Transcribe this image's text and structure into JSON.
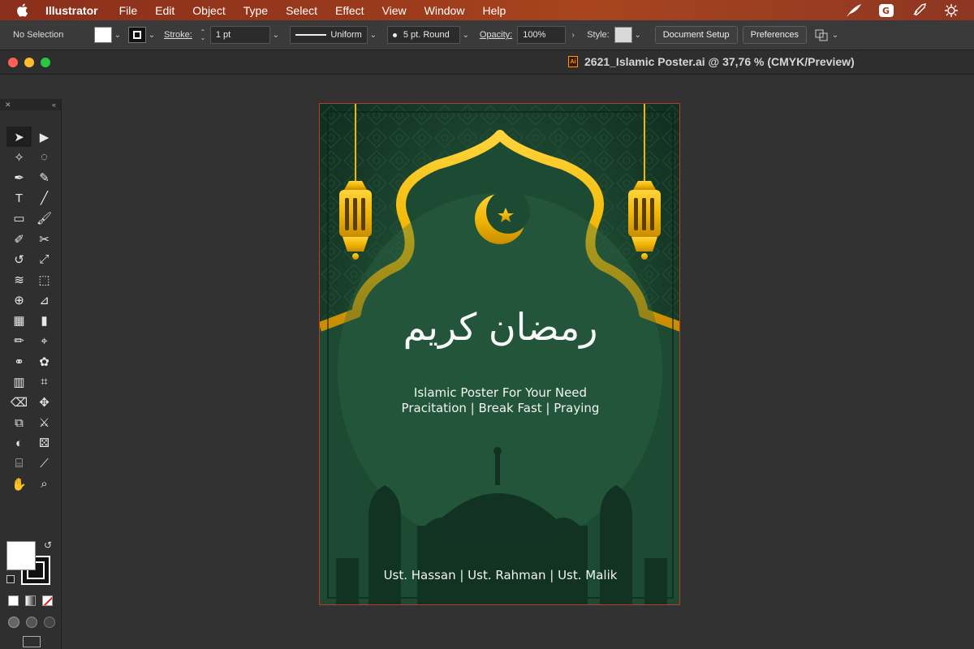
{
  "menubar": {
    "app_name": "Illustrator",
    "items": [
      "File",
      "Edit",
      "Object",
      "Type",
      "Select",
      "Effect",
      "View",
      "Window",
      "Help"
    ]
  },
  "controlbar": {
    "selection": "No Selection",
    "stroke_label": "Stroke:",
    "stroke_value": "1 pt",
    "stroke_profile": "Uniform",
    "brush": "5 pt. Round",
    "opacity_label": "Opacity:",
    "opacity_value": "100%",
    "style_label": "Style:",
    "document_setup": "Document Setup",
    "preferences": "Preferences"
  },
  "document": {
    "title": "2621_Islamic Poster.ai @ 37,76 % (CMYK/Preview)",
    "badge": "Ai"
  },
  "poster": {
    "calligraphy": "رمضان كريم",
    "line1": "Islamic Poster For Your Need",
    "line2": "Pracitation | Break Fast | Praying",
    "footer": "Ust. Hassan | Ust. Rahman | Ust. Malik"
  },
  "colors": {
    "gold": "#f2b705",
    "poster_green": "#1e4a32",
    "artboard_outline": "#c0392b"
  },
  "tools": [
    "selection-tool-icon",
    "direct-selection-tool-icon",
    "magic-wand-tool-icon",
    "lasso-tool-icon",
    "pen-tool-icon",
    "curvature-tool-icon",
    "type-tool-icon",
    "line-segment-tool-icon",
    "rectangle-tool-icon",
    "paintbrush-tool-icon",
    "shaper-tool-icon",
    "scissors-tool-icon",
    "rotate-tool-icon",
    "scale-tool-icon",
    "width-tool-icon",
    "free-transform-tool-icon",
    "shape-builder-tool-icon",
    "perspective-grid-tool-icon",
    "mesh-tool-icon",
    "gradient-tool-icon",
    "eyedropper-tool-icon",
    "measure-tool-icon",
    "blend-tool-icon",
    "symbol-sprayer-tool-icon",
    "column-graph-tool-icon",
    "slice-tool-icon",
    "eraser-tool-icon",
    "puppet-warp-tool-icon",
    "artboard-tool-icon",
    "knife-tool-icon",
    "gradient-mesh-tool-icon",
    "dice-icon",
    "crop-tool-icon",
    "paint-tool-icon",
    "hand-tool-icon",
    "zoom-tool-icon"
  ]
}
